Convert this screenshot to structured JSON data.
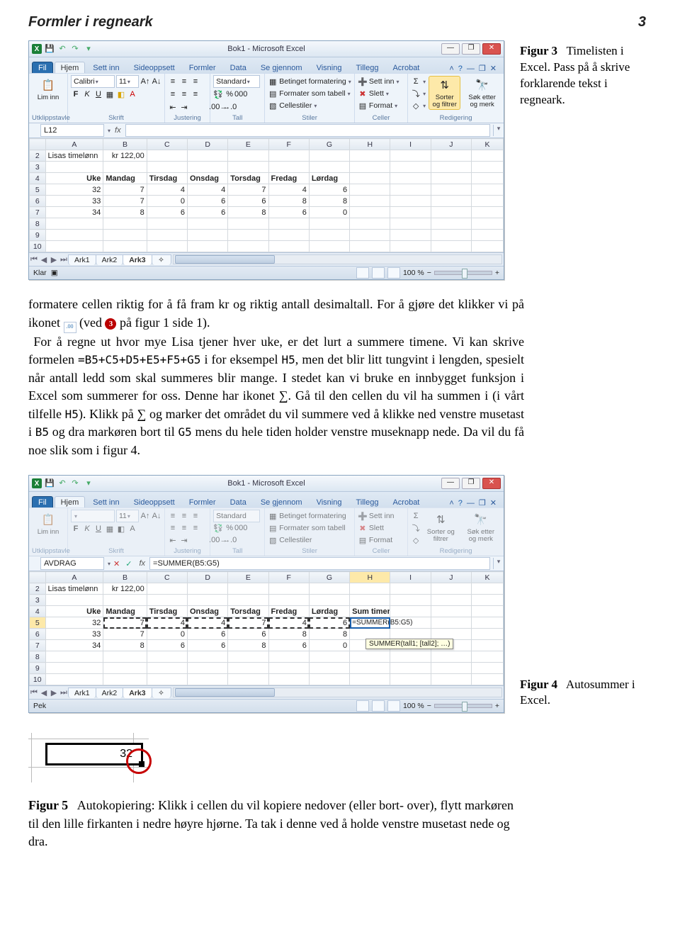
{
  "header": {
    "title": "Formler i regneark",
    "page": "3"
  },
  "fig3": {
    "label": "Figur 3",
    "caption": "Timelisten i Excel. Pass på å skrive forklarende tekst i regneark."
  },
  "fig4": {
    "label": "Figur 4",
    "caption": "Autosummer i Excel."
  },
  "fig5": {
    "label": "Figur 5",
    "cell_value": "32",
    "caption": "Autokopiering: Klikk i cellen du vil kopiere nedover (eller bort- over), flytt markøren til den lille firkanten i nedre høyre hjørne. Ta tak i denne ved å holde venstre musetast nede og dra."
  },
  "para1": "formatere cellen riktig for å få fram kr og riktig antall desimaltall. For å gjøre det klikker vi på ikonet",
  "para1b": "(ved",
  "para1c": "på figur 1 side 1).",
  "para2": "For å regne ut hvor mye Lisa tjener hver uke, er det lurt a summere timene. Vi kan skrive formelen",
  "formula_text": "=B5+C5+D5+E5+F5+G5",
  "para2b": "i for eksempel",
  "code_h5": "H5",
  "para2c": ", men det blir litt tungvint i lengden, spesielt når antall ledd som skal summeres blir mange. I stedet kan vi bruke en innbygget funksjon i Excel som summerer for oss. Denne har ikonet ∑. Gå til den cellen du vil ha summen i (i vårt tilfelle",
  "para2d": "). Klikk på ∑ og marker det området du vil summere ved å klikke ned venstre musetast i",
  "code_b5": "B5",
  "para2e": "og dra markøren bort til",
  "code_g5": "G5",
  "para2f": "mens du hele tiden holder venstre museknapp nede. Da vil du få noe slik som i figur 4.",
  "excel": {
    "win_title": "Bok1 - Microsoft Excel",
    "tabs": [
      "Fil",
      "Hjem",
      "Sett inn",
      "Sideoppsett",
      "Formler",
      "Data",
      "Se gjennom",
      "Visning",
      "Tillegg",
      "Acrobat"
    ],
    "ribbon": {
      "groups": [
        "Utklippstavle",
        "Skrift",
        "Justering",
        "Tall",
        "Stiler",
        "Celler",
        "Redigering"
      ],
      "paste": "Lim inn",
      "font_name": "Calibri",
      "font_size": "11",
      "number_format": "Standard",
      "cond_fmt": "Betinget formatering",
      "fmt_table": "Formater som tabell",
      "cell_styles": "Cellestiler",
      "insert": "Sett inn",
      "delete": "Slett",
      "format": "Format",
      "sort": "Sorter og filtrer",
      "find": "Søk etter og merk"
    },
    "fig3": {
      "name_box": "L12",
      "formula": "",
      "status": "Klar",
      "zoom": "100 %"
    },
    "fig4": {
      "name_box": "AVDRAG",
      "formula": "=SUMMER(B5:G5)",
      "status": "Pek",
      "zoom": "100 %",
      "cell_formula": "=SUMMER(B5:G5)",
      "tooltip": "SUMMER(tall1; [tall2]; …)",
      "sum_header": "Sum timer"
    },
    "cols": [
      "A",
      "B",
      "C",
      "D",
      "E",
      "F",
      "G",
      "H",
      "I",
      "J",
      "K"
    ],
    "rows_label": [
      "2",
      "3",
      "4",
      "5",
      "6",
      "7",
      "8",
      "9",
      "10"
    ],
    "sheets": [
      "Ark1",
      "Ark2",
      "Ark3"
    ],
    "active_sheet": 2,
    "chart_data": {
      "type": "table",
      "title_row": {
        "A": "Lisas timelønn",
        "B": "kr   122,00"
      },
      "header_row": {
        "A": "Uke",
        "B": "Mandag",
        "C": "Tirsdag",
        "D": "Onsdag",
        "E": "Torsdag",
        "F": "Fredag",
        "G": "Lørdag"
      },
      "data": [
        {
          "A": 32,
          "B": 7,
          "C": 4,
          "D": 4,
          "E": 7,
          "F": 4,
          "G": 6
        },
        {
          "A": 33,
          "B": 7,
          "C": 0,
          "D": 6,
          "E": 6,
          "F": 8,
          "G": 8
        },
        {
          "A": 34,
          "B": 8,
          "C": 6,
          "D": 6,
          "E": 8,
          "F": 6,
          "G": 0
        }
      ]
    }
  }
}
